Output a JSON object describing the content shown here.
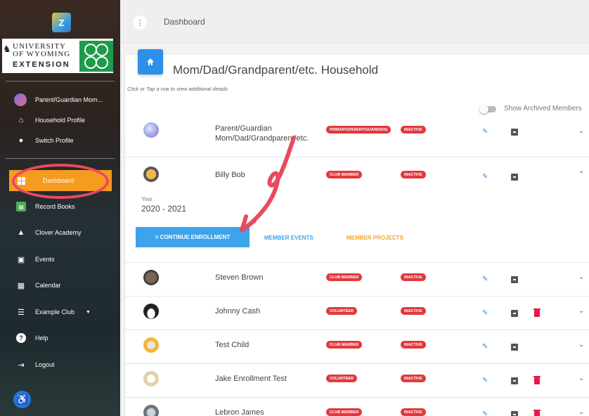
{
  "sidebar": {
    "logo_text": "Z",
    "uw_logo": {
      "line1": "UNIVERSITY",
      "line2": "OF WYOMING",
      "line3": "EXTENSION"
    },
    "profile_name": "Parent/Guardian Mom...",
    "items": [
      {
        "label": "Household Profile",
        "icon": "home-icon"
      },
      {
        "label": "Switch Profile",
        "icon": "person-icon"
      },
      {
        "label": "Dashboard",
        "icon": "dashboard-icon"
      },
      {
        "label": "Record Books",
        "icon": "record-books-icon"
      },
      {
        "label": "Clover Academy",
        "icon": "graduation-cap-icon"
      },
      {
        "label": "Events",
        "icon": "calendar-event-icon"
      },
      {
        "label": "Calendar",
        "icon": "calendar-icon"
      },
      {
        "label": "Example Club",
        "icon": "club-list-icon"
      },
      {
        "label": "Help",
        "icon": "help-icon"
      },
      {
        "label": "Logout",
        "icon": "logout-icon"
      }
    ]
  },
  "topbar": {
    "breadcrumb": "Dashboard"
  },
  "household": {
    "title": "Mom/Dad/Grandparent/etc. Household",
    "hint": "Click or Tap a row to view additional details",
    "show_archived_label": "Show Archived Members",
    "show_archived": false
  },
  "members": [
    {
      "name": "Parent/Guardian\nMom/Dad/Grandparent/etc.",
      "role": "PRIMARY(PARENT/GUARDIAN)",
      "status": "INACTIVE",
      "deletable": false,
      "expanded": false
    },
    {
      "name": "Billy Bob",
      "role": "CLUB MEMBER",
      "status": "INACTIVE",
      "deletable": false,
      "expanded": true
    },
    {
      "name": "Steven Brown",
      "role": "CLUB MEMBER",
      "status": "INACTIVE",
      "deletable": false,
      "expanded": false
    },
    {
      "name": "Johnny Cash",
      "role": "VOLUNTEER",
      "status": "INACTIVE",
      "deletable": true,
      "expanded": false
    },
    {
      "name": "Test Child",
      "role": "CLUB MEMBER",
      "status": "INACTIVE",
      "deletable": false,
      "expanded": false
    },
    {
      "name": "Jake Enrollment Test",
      "role": "VOLUNTEER",
      "status": "INACTIVE",
      "deletable": true,
      "expanded": false
    },
    {
      "name": "Lebron James",
      "role": "CLUB MEMBER",
      "status": "INACTIVE",
      "deletable": true,
      "expanded": false
    }
  ],
  "expanded_detail": {
    "year_label": "Year",
    "year_value": "2020 - 2021",
    "continue_label": "> CONTINUE ENROLLMENT",
    "events_label": "MEMBER EVENTS",
    "projects_label": "MEMBER PROJECTS"
  },
  "colors": {
    "accent_blue": "#2f8fe8",
    "dashboard_orange": "#f59b1f",
    "pill_red": "#e0393e",
    "delete_pink": "#e8174c",
    "annotation_red": "#e84a5f",
    "projects_orange": "#f5a623"
  }
}
